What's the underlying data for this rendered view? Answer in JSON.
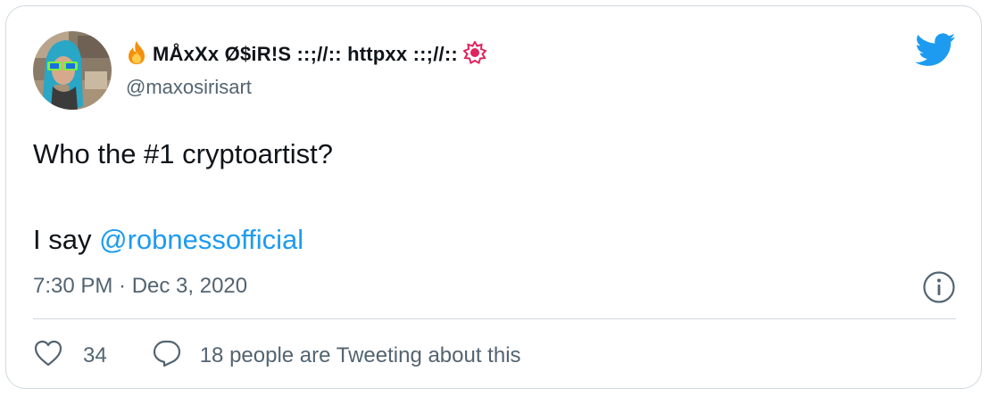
{
  "author": {
    "display_name": "MÅxXx Ø$iR!S ::;//:: httpxx ::;//::",
    "handle": "@maxosirisart",
    "name_prefix_emoji": "fire-emoji",
    "name_suffix_emoji": "red-star-badge-emoji"
  },
  "tweet": {
    "line1": "Who the #1 cryptoartist?",
    "line2_prefix": "I say ",
    "mention": "@robnessofficial",
    "timestamp": "7:30 PM · Dec 3, 2020"
  },
  "actions": {
    "likes_count": "34",
    "reply_label": "18 people are Tweeting about this"
  },
  "icons": {
    "brand": "twitter-bird-icon",
    "info": "info-icon",
    "like": "heart-icon",
    "reply": "speech-bubble-icon"
  },
  "colors": {
    "accent": "#1d9bf0",
    "text": "#0f1419",
    "secondary": "#536471",
    "border": "#cfd9de"
  }
}
